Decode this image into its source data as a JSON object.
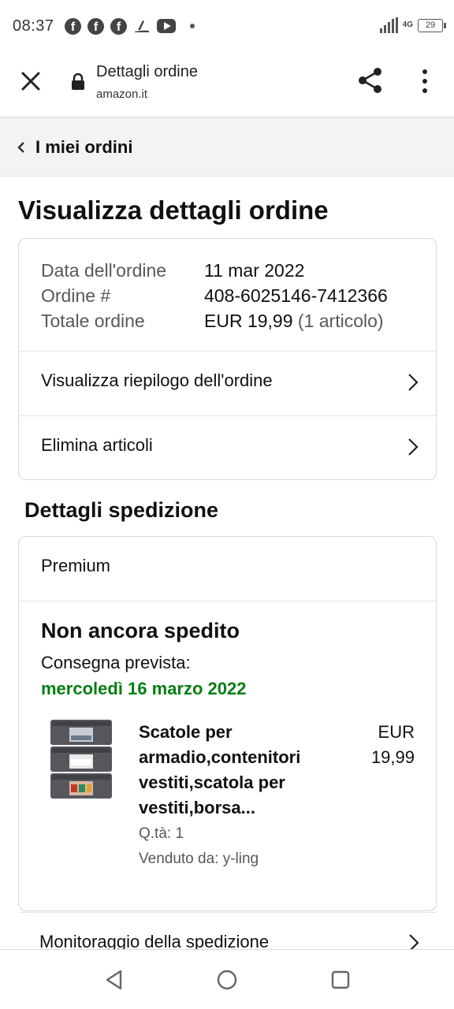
{
  "status_bar": {
    "time": "08:37",
    "network": "4G",
    "battery": "29"
  },
  "browser": {
    "page_title": "Dettagli ordine",
    "domain": "amazon.it"
  },
  "breadcrumb": {
    "label": "I miei ordini"
  },
  "page": {
    "title": "Visualizza dettagli ordine"
  },
  "order_summary": {
    "date_label": "Data dell'ordine",
    "date_value": "11 mar 2022",
    "number_label": "Ordine #",
    "number_value": "408-6025146-7412366",
    "total_label": "Totale ordine",
    "total_value": "EUR 19,99",
    "total_items": "(1 articolo)"
  },
  "actions": {
    "view_summary": "Visualizza riepilogo dell'ordine",
    "delete_items": "Elimina articoli"
  },
  "shipping": {
    "section_title": "Dettagli spedizione",
    "method": "Premium",
    "status": "Non ancora spedito",
    "eta_label": "Consegna prevista:",
    "eta_date": "mercoledì 16 marzo 2022",
    "tracking_label": "Monitoraggio della spedizione"
  },
  "item": {
    "name": "Scatole per armadio,contenitori vestiti,scatola per vestiti,borsa...",
    "price_currency": "EUR",
    "price_value": "19,99",
    "quantity": "Q.tà: 1",
    "seller": "Venduto da: y-ling"
  },
  "icons": {
    "close": "close-icon",
    "lock": "lock-icon",
    "share": "share-icon",
    "menu": "kebab-menu-icon",
    "back": "chevron-left-icon",
    "forward": "chevron-right-icon"
  },
  "colors": {
    "accent_green": "#067d14",
    "text": "#0f1111",
    "muted": "#565959",
    "border": "#d5d9d9"
  }
}
